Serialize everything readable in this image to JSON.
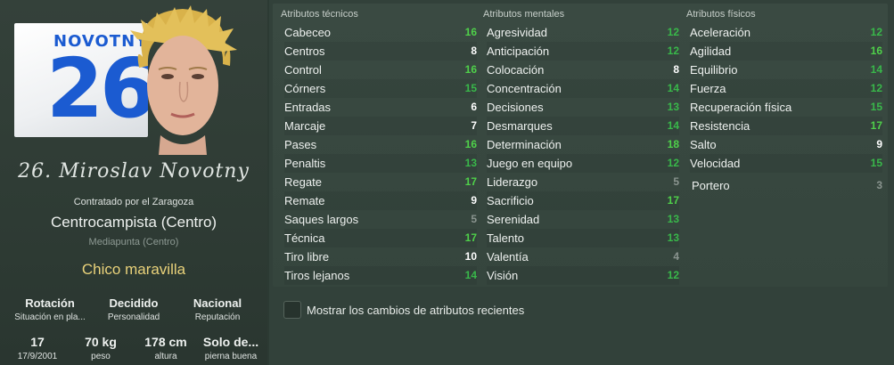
{
  "player": {
    "jersey_name": "NOVOTNY",
    "jersey_number": "26",
    "signature": "26. Miroslav Novotny",
    "contract": "Contratado por el Zaragoza",
    "position": "Centrocampista (Centro)",
    "subposition": "Mediapunta (Centro)",
    "tag": "Chico maravilla"
  },
  "info_row1": [
    {
      "value": "Rotación",
      "label": "Situación en pla..."
    },
    {
      "value": "Decidido",
      "label": "Personalidad"
    },
    {
      "value": "Nacional",
      "label": "Reputación"
    }
  ],
  "info_row2": [
    {
      "value": "17",
      "label": "17/9/2001"
    },
    {
      "value": "70 kg",
      "label": "peso"
    },
    {
      "value": "178 cm",
      "label": "altura"
    },
    {
      "value": "Solo de...",
      "label": "pierna buena"
    }
  ],
  "columns": {
    "technical": {
      "title": "Atributos técnicos",
      "items": [
        {
          "name": "Cabeceo",
          "value": "16",
          "color": "green"
        },
        {
          "name": "Centros",
          "value": "8",
          "color": "white"
        },
        {
          "name": "Control",
          "value": "16",
          "color": "green"
        },
        {
          "name": "Córners",
          "value": "15",
          "color": "dgreen"
        },
        {
          "name": "Entradas",
          "value": "6",
          "color": "white"
        },
        {
          "name": "Marcaje",
          "value": "7",
          "color": "white"
        },
        {
          "name": "Pases",
          "value": "16",
          "color": "green"
        },
        {
          "name": "Penaltis",
          "value": "13",
          "color": "dgreen"
        },
        {
          "name": "Regate",
          "value": "17",
          "color": "green"
        },
        {
          "name": "Remate",
          "value": "9",
          "color": "white"
        },
        {
          "name": "Saques largos",
          "value": "5",
          "color": "grey"
        },
        {
          "name": "Técnica",
          "value": "17",
          "color": "green"
        },
        {
          "name": "Tiro libre",
          "value": "10",
          "color": "white"
        },
        {
          "name": "Tiros lejanos",
          "value": "14",
          "color": "dgreen"
        }
      ]
    },
    "mental": {
      "title": "Atributos mentales",
      "items": [
        {
          "name": "Agresividad",
          "value": "12",
          "color": "dgreen"
        },
        {
          "name": "Anticipación",
          "value": "12",
          "color": "dgreen"
        },
        {
          "name": "Colocación",
          "value": "8",
          "color": "white"
        },
        {
          "name": "Concentración",
          "value": "14",
          "color": "dgreen"
        },
        {
          "name": "Decisiones",
          "value": "13",
          "color": "dgreen"
        },
        {
          "name": "Desmarques",
          "value": "14",
          "color": "dgreen"
        },
        {
          "name": "Determinación",
          "value": "18",
          "color": "green"
        },
        {
          "name": "Juego en equipo",
          "value": "12",
          "color": "dgreen"
        },
        {
          "name": "Liderazgo",
          "value": "5",
          "color": "grey"
        },
        {
          "name": "Sacrificio",
          "value": "17",
          "color": "green"
        },
        {
          "name": "Serenidad",
          "value": "13",
          "color": "dgreen"
        },
        {
          "name": "Talento",
          "value": "13",
          "color": "dgreen"
        },
        {
          "name": "Valentía",
          "value": "4",
          "color": "grey"
        },
        {
          "name": "Visión",
          "value": "12",
          "color": "dgreen"
        }
      ]
    },
    "physical": {
      "title": "Atributos físicos",
      "items": [
        {
          "name": "Aceleración",
          "value": "12",
          "color": "dgreen"
        },
        {
          "name": "Agilidad",
          "value": "16",
          "color": "green"
        },
        {
          "name": "Equilibrio",
          "value": "14",
          "color": "dgreen"
        },
        {
          "name": "Fuerza",
          "value": "12",
          "color": "dgreen"
        },
        {
          "name": "Recuperación física",
          "value": "15",
          "color": "dgreen"
        },
        {
          "name": "Resistencia",
          "value": "17",
          "color": "green"
        },
        {
          "name": "Salto",
          "value": "9",
          "color": "white"
        },
        {
          "name": "Velocidad",
          "value": "15",
          "color": "dgreen"
        }
      ],
      "goalkeeper": {
        "name": "Portero",
        "value": "3",
        "color": "grey"
      }
    }
  },
  "checkbox": {
    "label": "Mostrar los cambios de atributos recientes"
  },
  "colors": {
    "green": "#4fd14a",
    "dgreen": "#39b84a",
    "white": "#ffffff",
    "grey": "#8a948f"
  }
}
